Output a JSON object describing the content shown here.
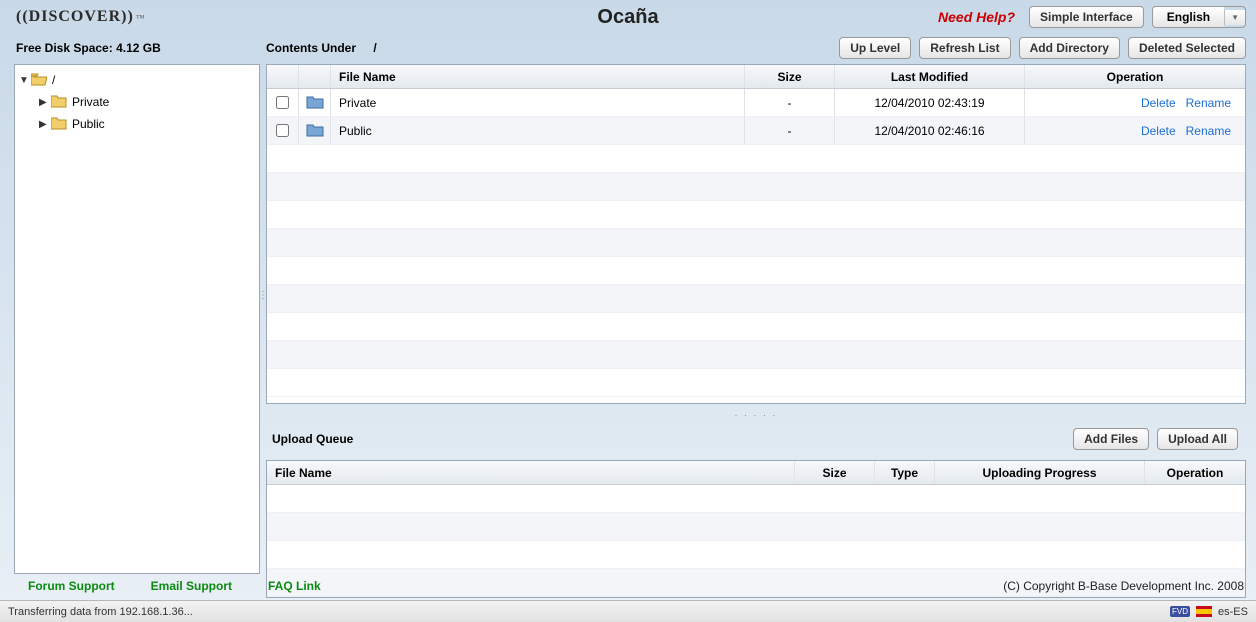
{
  "header": {
    "logo_text": "((DISCOVER))",
    "logo_tm": "™",
    "title": "Ocaña",
    "need_help": "Need Help?",
    "simple_interface": "Simple Interface",
    "language": "English"
  },
  "toolbar": {
    "disk_space_label": "Free Disk Space:",
    "disk_space_value": "4.12 GB",
    "contents_under": "Contents Under",
    "path": "/",
    "up_level": "Up Level",
    "refresh_list": "Refresh List",
    "add_directory": "Add Directory",
    "deleted_selected": "Deleted Selected"
  },
  "tree": {
    "root": {
      "label": "/",
      "expanded": true
    },
    "children": [
      {
        "label": "Private"
      },
      {
        "label": "Public"
      }
    ]
  },
  "file_table": {
    "headers": {
      "file_name": "File Name",
      "size": "Size",
      "last_modified": "Last Modified",
      "operation": "Operation"
    },
    "rows": [
      {
        "name": "Private",
        "size": "-",
        "modified": "12/04/2010 02:43:19"
      },
      {
        "name": "Public",
        "size": "-",
        "modified": "12/04/2010 02:46:16"
      }
    ],
    "op_delete": "Delete",
    "op_rename": "Rename"
  },
  "upload": {
    "title": "Upload Queue",
    "add_files": "Add Files",
    "upload_all": "Upload All",
    "headers": {
      "file_name": "File Name",
      "size": "Size",
      "type": "Type",
      "progress": "Uploading Progress",
      "operation": "Operation"
    }
  },
  "footer": {
    "forum": "Forum Support",
    "email": "Email Support",
    "faq": "FAQ Link",
    "copyright": "(C) Copyright B-Base Development Inc. 2008"
  },
  "status": {
    "text": "Transferring data from 192.168.1.36...",
    "locale": "es-ES"
  }
}
